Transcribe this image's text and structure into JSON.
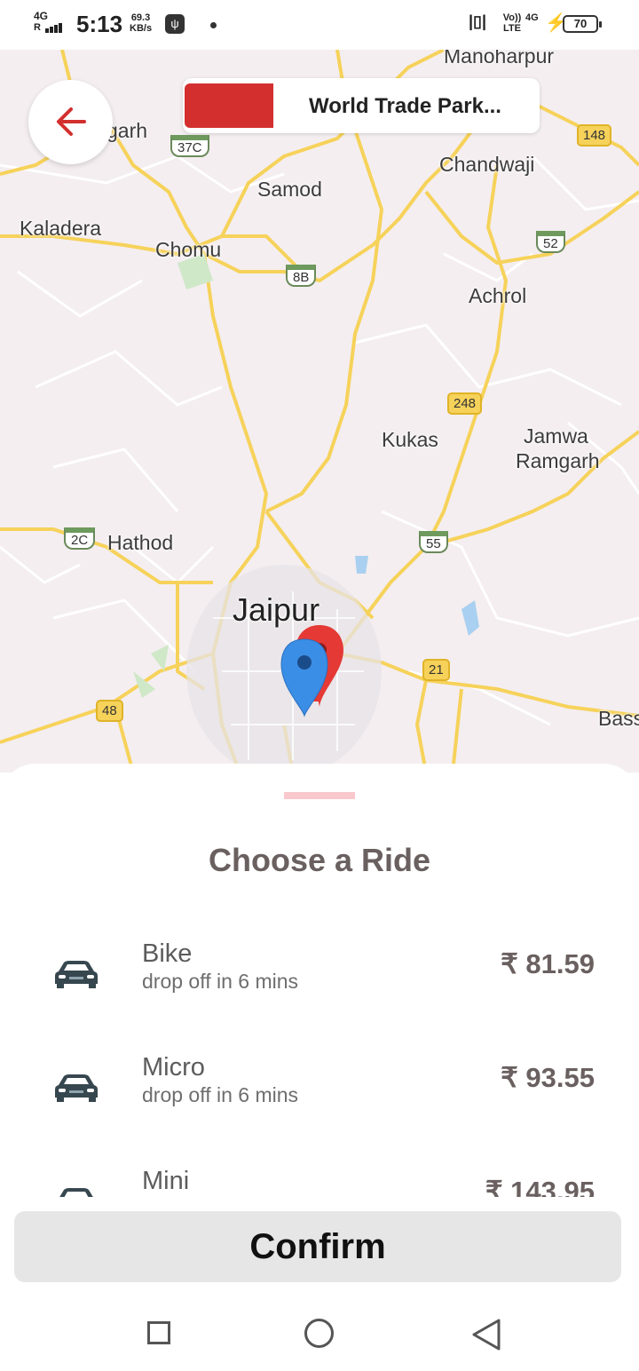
{
  "status_bar": {
    "network": "4G",
    "time": "5:13",
    "speed_value": "69.3",
    "speed_unit": "KB/s",
    "volte": "Vo)) LTE",
    "data_type": "4G",
    "battery": "70"
  },
  "map": {
    "destination": "World Trade Park...",
    "labels": [
      "Manoharpur",
      "garh",
      "Chandwaji",
      "Samod",
      "Kaladera",
      "Chomu",
      "Achrol",
      "Kukas",
      "Jamwa",
      "Ramgarh",
      "Hathod",
      "Jaipur",
      "Bass"
    ],
    "road_numbers": [
      "148",
      "37C",
      "52",
      "8B",
      "248",
      "2C",
      "55",
      "21",
      "48"
    ],
    "colors": {
      "roads": "#f6d25a",
      "background": "#f4eef0",
      "pin_destination": "#e53935",
      "pin_origin": "#3b8ee6"
    }
  },
  "sheet": {
    "title": "Choose a Ride",
    "rides": [
      {
        "name": "Bike",
        "eta": "drop off in 6 mins",
        "price": "₹ 81.59",
        "icon": "car-icon"
      },
      {
        "name": "Micro",
        "eta": "drop off in 6 mins",
        "price": "₹ 93.55",
        "icon": "car-icon"
      },
      {
        "name": "Mini",
        "eta": "",
        "price": "₹ 143.95",
        "icon": "car-icon"
      }
    ],
    "confirm_label": "Confirm"
  },
  "nav": {
    "icons": [
      "recent-apps-icon",
      "home-icon",
      "back-icon"
    ]
  }
}
